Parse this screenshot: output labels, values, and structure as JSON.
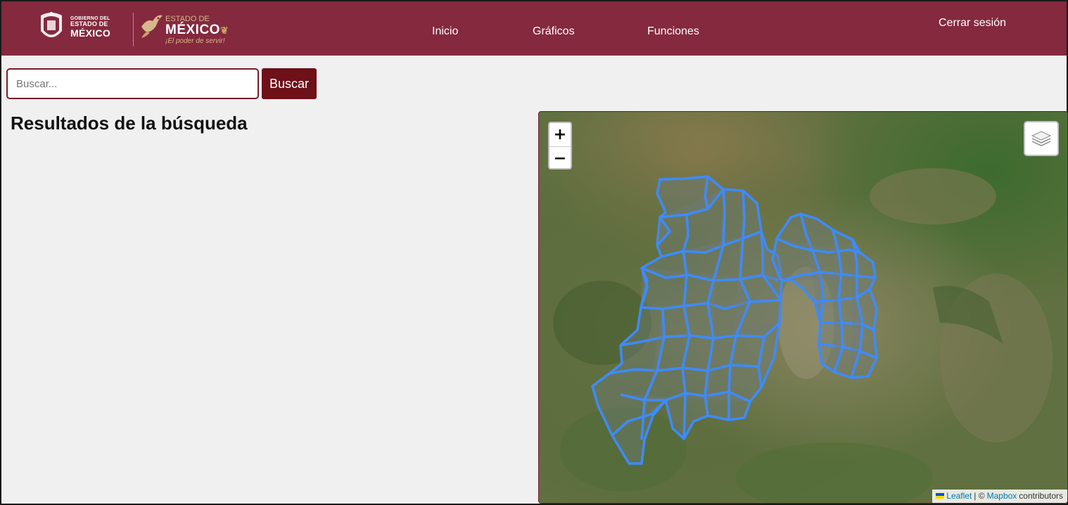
{
  "header": {
    "gov_logo": {
      "line1": "GOBIERNO DEL",
      "line2": "ESTADO DE",
      "line3": "MÉXICO"
    },
    "estado_logo": {
      "line1": "ESTADO DE",
      "line2": "MÉXICO",
      "slogan": "¡El poder de servir!"
    },
    "nav": [
      {
        "label": "Inicio"
      },
      {
        "label": "Gráficos"
      },
      {
        "label": "Funciones"
      }
    ],
    "logout_label": "Cerrar sesión",
    "background_color": "#84293e"
  },
  "search": {
    "placeholder": "Buscar...",
    "value": "",
    "button_label": "Buscar",
    "button_color": "#6e1119"
  },
  "results": {
    "title": "Resultados de la búsqueda"
  },
  "map": {
    "zoom_in_label": "+",
    "zoom_out_label": "−",
    "layers_icon": "layers-icon",
    "boundary_color": "#3d8bff",
    "attribution": {
      "leaflet": "Leaflet",
      "separator": "| ©",
      "provider": "Mapbox",
      "suffix": "contributors"
    }
  }
}
